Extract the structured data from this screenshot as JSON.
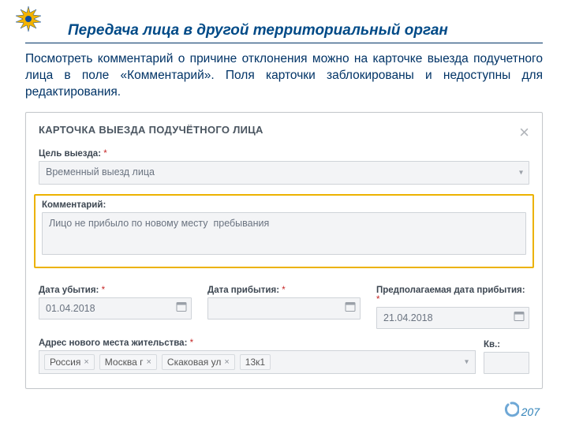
{
  "header": {
    "title": "Передача лица в другой территориальный орган"
  },
  "body_text": "Посмотреть комментарий о причине отклонения можно на карточке выезда подучетного лица в поле «Комментарий». Поля карточки заблокированы и недоступны для редактирования.",
  "card": {
    "title": "КАРТОЧКА ВЫЕЗДА ПОДУЧЁТНОГО ЛИЦА",
    "purpose_label": "Цель выезда:",
    "purpose_value": "Временный выезд лица",
    "comment_label": "Комментарий:",
    "comment_value": "Лицо не прибыло по новому месту  пребывания",
    "dates": {
      "departure_label": "Дата убытия:",
      "departure_value": "01.04.2018",
      "arrival_label": "Дата прибытия:",
      "arrival_value": "",
      "expected_label": "Предполагаемая дата прибытия:",
      "expected_value": "21.04.2018"
    },
    "address_label": "Адрес нового места жительства:",
    "kv_label": "Кв.:",
    "address_tags": [
      "Россия",
      "Москва г",
      "Скаковая ул",
      "13к1"
    ]
  },
  "page_number": "207"
}
